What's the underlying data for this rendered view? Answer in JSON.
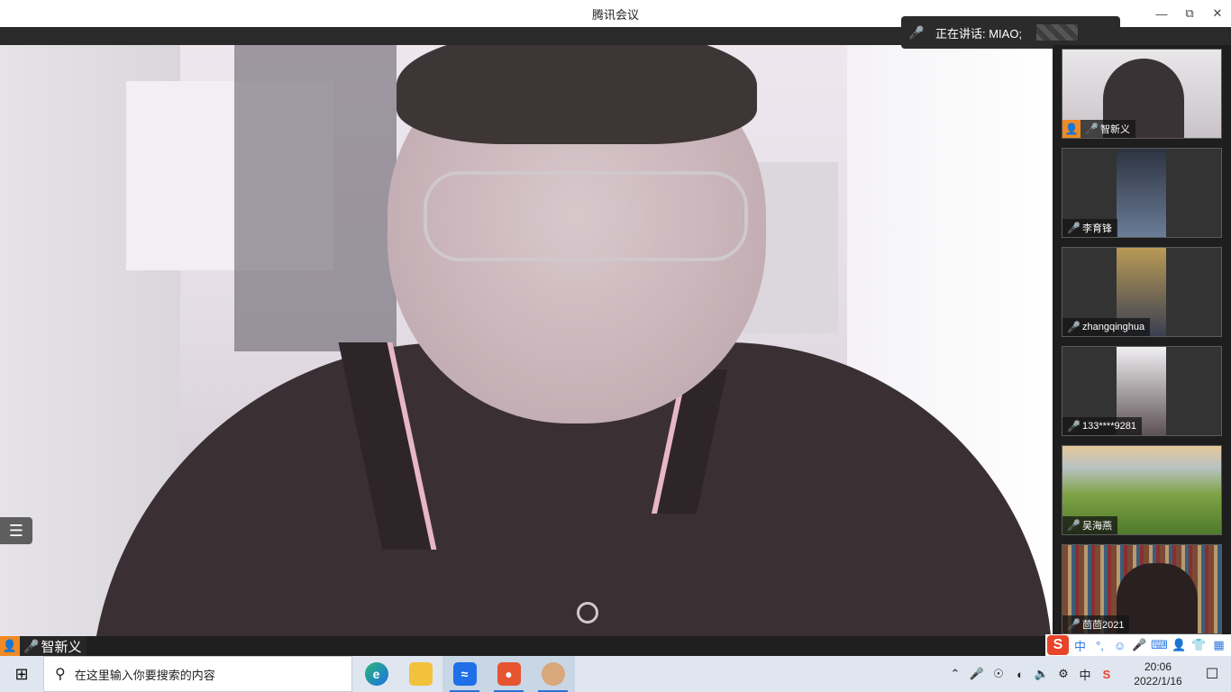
{
  "window": {
    "title": "腾讯会议"
  },
  "speaking": {
    "label": "正在讲话: MIAO;"
  },
  "main_speaker": {
    "name": "智新义"
  },
  "participants": [
    {
      "name": "智新义",
      "host": true,
      "muted": false,
      "bg": "#cfc7c9"
    },
    {
      "name": "李育锋",
      "host": false,
      "muted": true,
      "bg": "#2f2f35"
    },
    {
      "name": "zhangqinghua",
      "host": false,
      "muted": true,
      "bg": "#6b5840"
    },
    {
      "name": "133****9281",
      "host": false,
      "muted": true,
      "bg": "#e4e3e6"
    },
    {
      "name": "吴海燕",
      "host": false,
      "muted": true,
      "bg": "#7a9b3a"
    },
    {
      "name": "茴茴2021",
      "host": false,
      "muted": true,
      "bg": "#6a4d3a"
    }
  ],
  "taskbar": {
    "search_placeholder": "在这里输入你要搜索的内容",
    "time": "20:06",
    "date": "2022/1/16",
    "ime_lang": "中",
    "ime_toolbar_lang": "中"
  }
}
